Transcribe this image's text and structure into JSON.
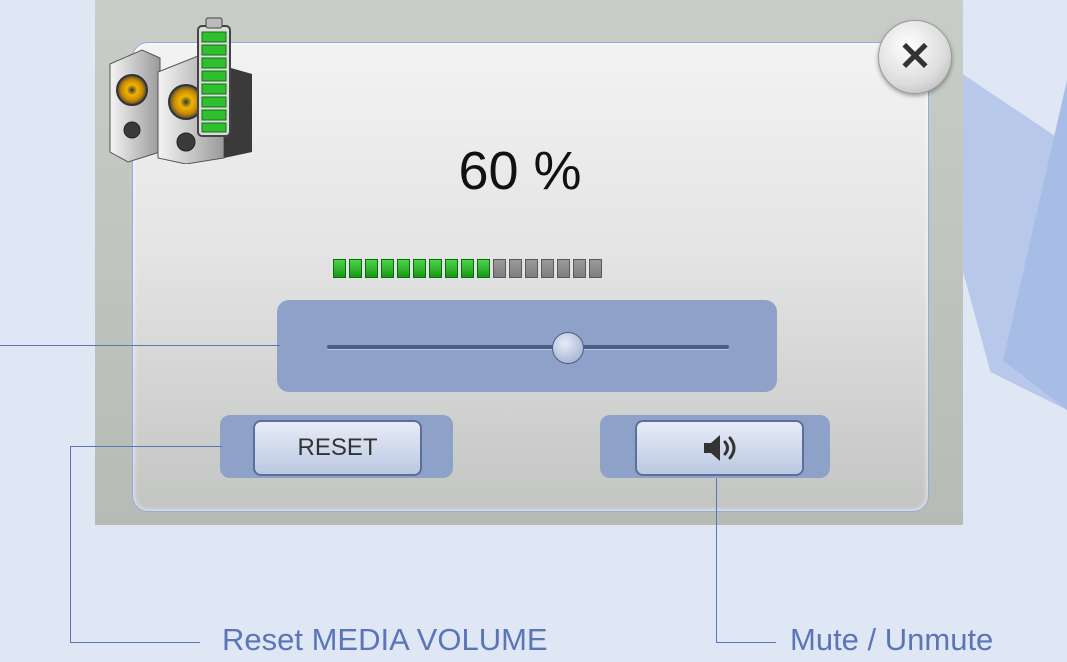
{
  "volume": {
    "level_text": "60 %",
    "level_percent": 60,
    "segments_total": 17,
    "segments_on": 10
  },
  "slider": {
    "value_percent": 60
  },
  "buttons": {
    "reset_label": "RESET",
    "close_glyph": "✕",
    "mute_glyph": "🔈"
  },
  "icons": {
    "header": "speaker-battery-icon",
    "mute": "speaker-sound-icon",
    "close": "close-icon"
  },
  "callouts": {
    "reset": "Reset MEDIA VOLUME",
    "mute": "Mute / Unmute"
  },
  "colors": {
    "meter_on": "#1fb31f",
    "meter_off": "#8a8a8a",
    "accent": "#5b76b8",
    "control_bg": "#8ea2c9"
  }
}
